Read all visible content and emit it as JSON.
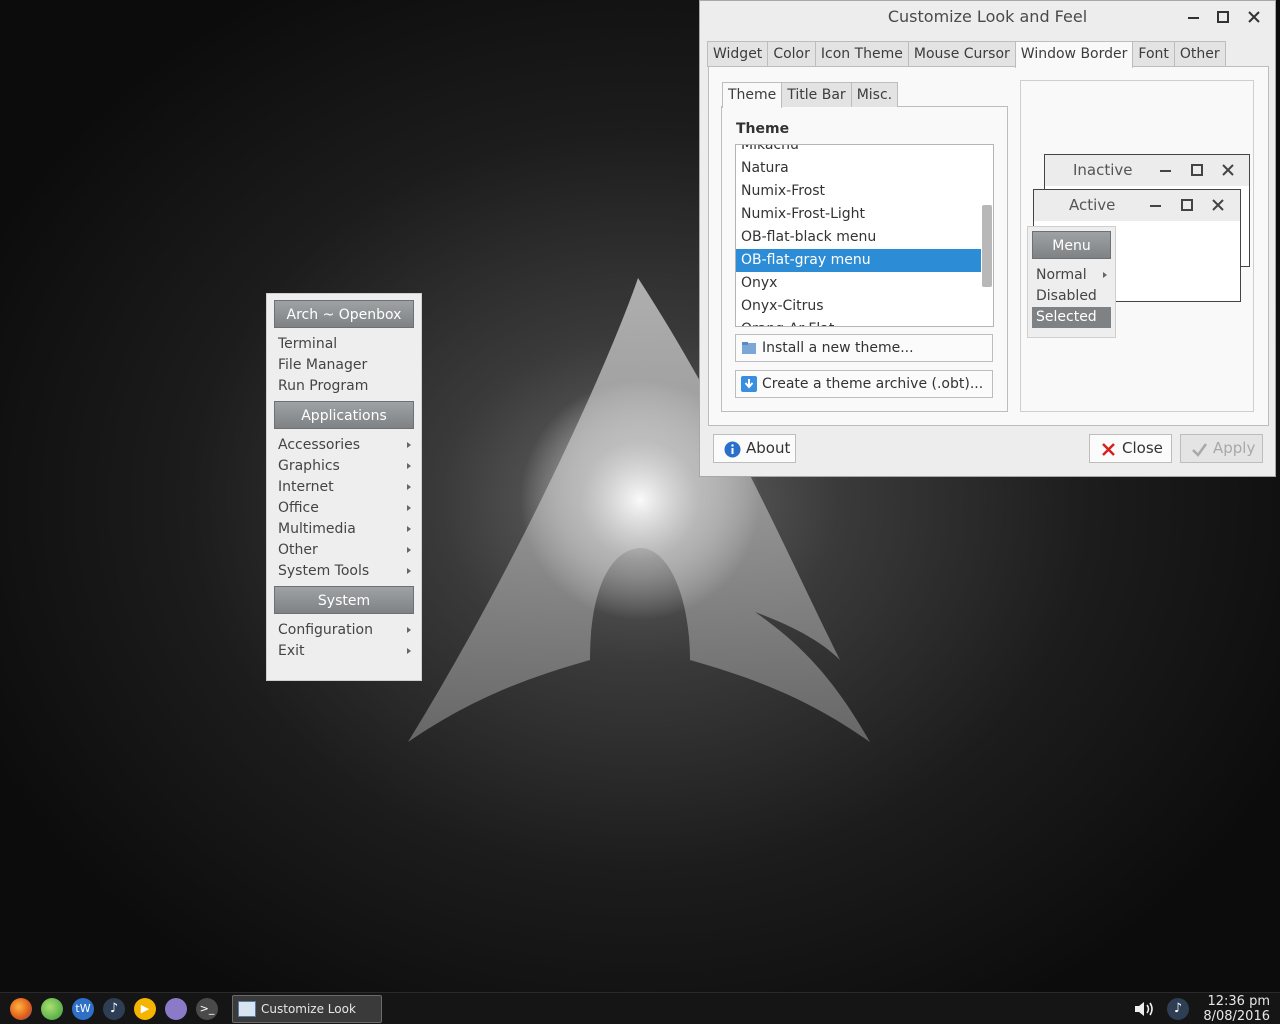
{
  "openbox_menu": {
    "header1": "Arch ~ Openbox",
    "top_items": [
      "Terminal",
      "File Manager",
      "Run Program"
    ],
    "header2": "Applications",
    "app_items": [
      "Accessories",
      "Graphics",
      "Internet",
      "Office",
      "Multimedia",
      "Other",
      "System Tools"
    ],
    "header3": "System",
    "system_items": [
      "Configuration",
      "Exit"
    ]
  },
  "dialog": {
    "title": "Customize Look and Feel",
    "tabs": [
      "Widget",
      "Color",
      "Icon Theme",
      "Mouse Cursor",
      "Window Border",
      "Font",
      "Other"
    ],
    "active_tab": "Window Border",
    "subtabs": [
      "Theme",
      "Title Bar",
      "Misc."
    ],
    "active_subtab": "Theme",
    "theme_section_label": "Theme",
    "themes": [
      "Mikachu",
      "Natura",
      "Numix-Frost",
      "Numix-Frost-Light",
      "OB-flat-black menu",
      "OB-flat-gray menu",
      "Onyx",
      "Onyx-Citrus",
      "Orang-Ar-Flat"
    ],
    "selected_theme": "OB-flat-gray menu",
    "install_button": "Install a new theme...",
    "archive_button": "Create a theme archive (.obt)...",
    "preview": {
      "inactive_title": "Inactive",
      "active_title": "Active",
      "menu_header": "Menu",
      "menu_items": [
        "Normal",
        "Disabled",
        "Selected"
      ]
    },
    "about_button": "About",
    "close_button": "Close",
    "apply_button": "Apply"
  },
  "taskbar": {
    "task_label": "Customize Look an...",
    "clock_time": "12:36 pm",
    "clock_date": "8/08/2016",
    "launchers": [
      "firefox-icon",
      "web-browser-icon",
      "tw-icon",
      "music-icon",
      "media-player-icon",
      "file-manager-icon",
      "terminal-icon"
    ]
  },
  "colors": {
    "selection": "#2c8dd6",
    "menu_header": "#8b8e91"
  }
}
